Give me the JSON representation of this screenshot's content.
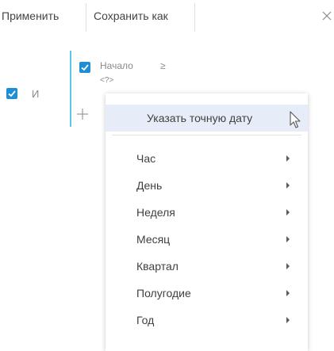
{
  "toolbar": {
    "apply_label": "Применить",
    "save_as_label": "Сохранить как"
  },
  "filter": {
    "group_operator": "И",
    "condition": {
      "column": "Начало",
      "operator": "≥",
      "value": "<?>"
    }
  },
  "context_menu": {
    "highlighted_item": "Указать точную дату",
    "items": [
      {
        "label": "Час"
      },
      {
        "label": "День"
      },
      {
        "label": "Неделя"
      },
      {
        "label": "Месяц"
      },
      {
        "label": "Квартал"
      },
      {
        "label": "Полугодие"
      },
      {
        "label": "Год"
      }
    ]
  },
  "colors": {
    "accent": "#1e8ed6",
    "group_line": "#5ac6e8",
    "highlight_bg": "#e6edf8"
  }
}
